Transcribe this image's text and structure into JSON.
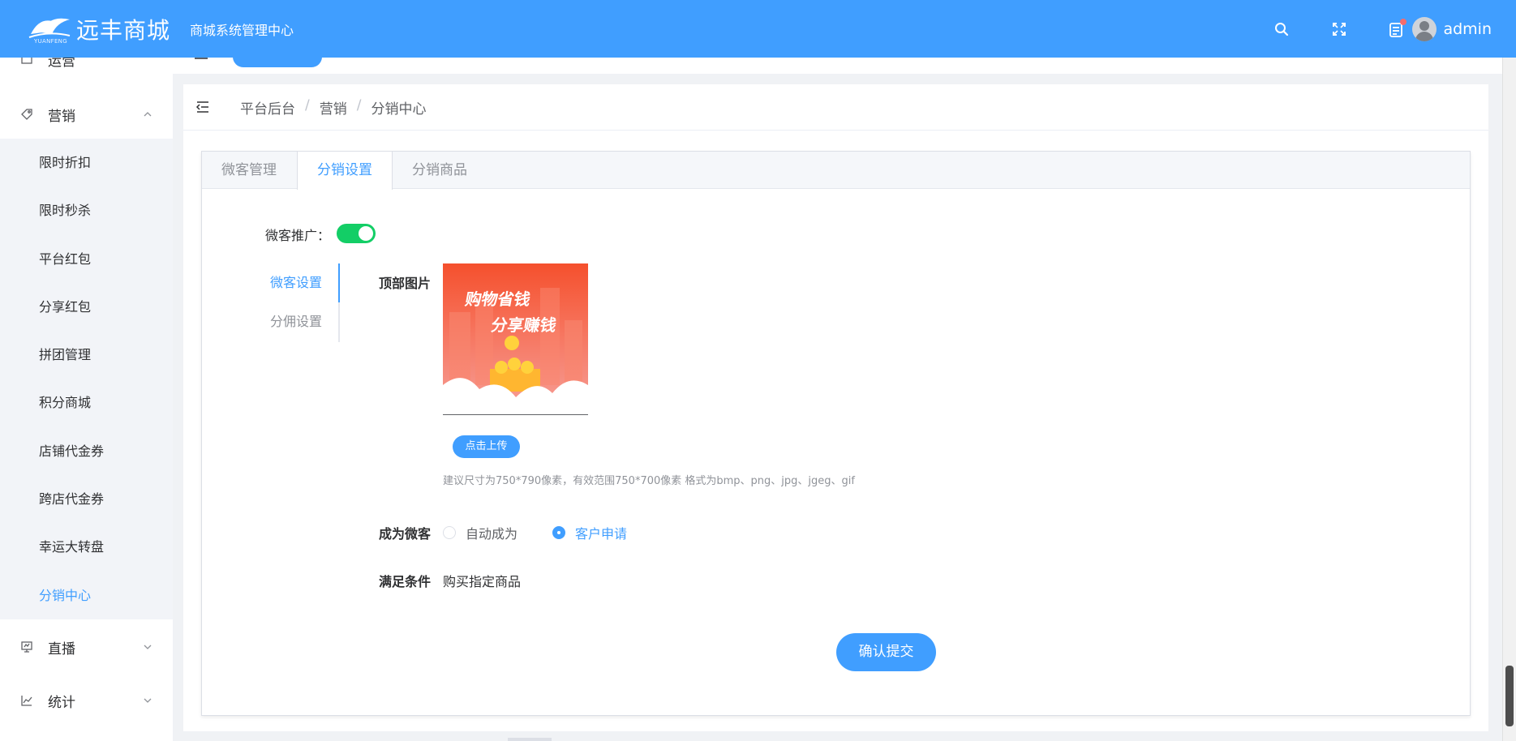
{
  "header": {
    "logo_text": "远丰商城",
    "logo_sub": "YUANFENG",
    "subtitle": "商城系统管理中心",
    "username": "admin",
    "icons": [
      "search-icon",
      "fullscreen-icon",
      "notice-icon"
    ],
    "notice_dot_color": "#f56c6c",
    "bg_color": "#409eff"
  },
  "sidebar": {
    "top_partial_item": "运营",
    "marketing": {
      "label": "营销",
      "expanded": true,
      "items": [
        {
          "label": "限时折扣"
        },
        {
          "label": "限时秒杀"
        },
        {
          "label": "平台红包"
        },
        {
          "label": "分享红包"
        },
        {
          "label": "拼团管理"
        },
        {
          "label": "积分商城"
        },
        {
          "label": "店铺代金券"
        },
        {
          "label": "跨店代金券"
        },
        {
          "label": "幸运大转盘"
        },
        {
          "label": "分销中心",
          "active": true
        }
      ]
    },
    "live": {
      "label": "直播"
    },
    "stats": {
      "label": "统计"
    },
    "active_color": "#409eff"
  },
  "breadcrumb": [
    "平台后台",
    "营销",
    "分销中心"
  ],
  "breadcrumb_separator": "/",
  "tabs": [
    {
      "label": "微客管理"
    },
    {
      "label": "分销设置",
      "active": true
    },
    {
      "label": "分销商品"
    }
  ],
  "form": {
    "promo_label": "微客推广：",
    "promo_enabled": true,
    "switch_color": "#13ce66",
    "vertical_tabs": [
      {
        "label": "微客设置",
        "active": true
      },
      {
        "label": "分佣设置"
      }
    ],
    "top_image_label": "顶部图片",
    "banner_line1": "购物省钱",
    "banner_line2": "分享赚钱",
    "upload_label": "点击上传",
    "hint": "建议尺寸为750*790像素，有效范围750*700像素 格式为bmp、png、jpg、jgeg、gif",
    "become_label": "成为微客",
    "become_options": [
      {
        "label": "自动成为",
        "checked": false
      },
      {
        "label": "客户申请",
        "checked": true
      }
    ],
    "condition_label": "满足条件",
    "condition_value": "购买指定商品",
    "submit_label": "确认提交"
  }
}
